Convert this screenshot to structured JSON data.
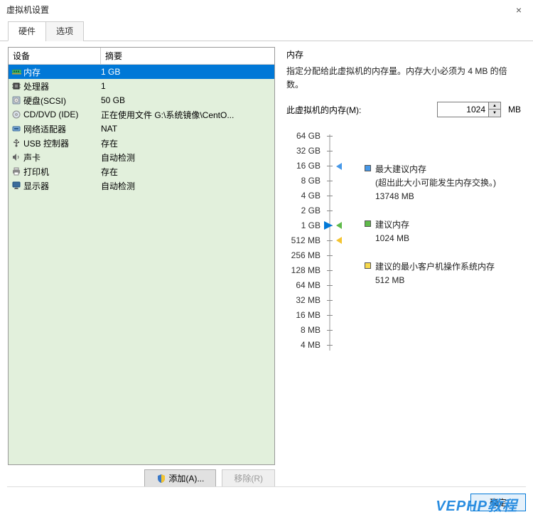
{
  "window": {
    "title": "虚拟机设置"
  },
  "tabs": {
    "hw": "硬件",
    "opt": "选项"
  },
  "hw_table": {
    "head_device": "设备",
    "head_summary": "摘要",
    "rows": [
      {
        "name": "内存",
        "summary": "1 GB",
        "icon": "memory",
        "selected": true
      },
      {
        "name": "处理器",
        "summary": "1",
        "icon": "cpu"
      },
      {
        "name": "硬盘(SCSI)",
        "summary": "50 GB",
        "icon": "disk"
      },
      {
        "name": "CD/DVD (IDE)",
        "summary": "正在使用文件 G:\\系统镜像\\CentO...",
        "icon": "cd"
      },
      {
        "name": "网络适配器",
        "summary": "NAT",
        "icon": "net"
      },
      {
        "name": "USB 控制器",
        "summary": "存在",
        "icon": "usb"
      },
      {
        "name": "声卡",
        "summary": "自动检测",
        "icon": "sound"
      },
      {
        "name": "打印机",
        "summary": "存在",
        "icon": "printer"
      },
      {
        "name": "显示器",
        "summary": "自动检测",
        "icon": "display"
      }
    ]
  },
  "buttons": {
    "add": "添加(A)...",
    "remove": "移除(R)",
    "ok": "确定"
  },
  "mem": {
    "group": "内存",
    "desc": "指定分配给此虚拟机的内存量。内存大小必须为 4 MB 的倍数。",
    "label": "此虚拟机的内存(M):",
    "value": "1024",
    "unit": "MB",
    "ticks": [
      "64 GB",
      "32 GB",
      "16 GB",
      "8 GB",
      "4 GB",
      "2 GB",
      "1 GB",
      "512 MB",
      "256 MB",
      "128 MB",
      "64 MB",
      "32 MB",
      "16 MB",
      "8 MB",
      "4 MB"
    ],
    "legend": {
      "max_title": "最大建议内存",
      "max_note": "(超出此大小可能发生内存交换。)",
      "max_val": "13748 MB",
      "rec_title": "建议内存",
      "rec_val": "1024 MB",
      "min_title": "建议的最小客户机操作系统内存",
      "min_val": "512 MB"
    },
    "colors": {
      "max_arrow": "#4698e8",
      "rec_arrow": "#5fba4a",
      "min_arrow": "#f4c430",
      "thumb": "#0078d7",
      "max_sq": "#4698e8",
      "rec_sq": "#5fba4a",
      "min_sq": "#f7d94c"
    }
  },
  "watermark": "VEPHP教程"
}
